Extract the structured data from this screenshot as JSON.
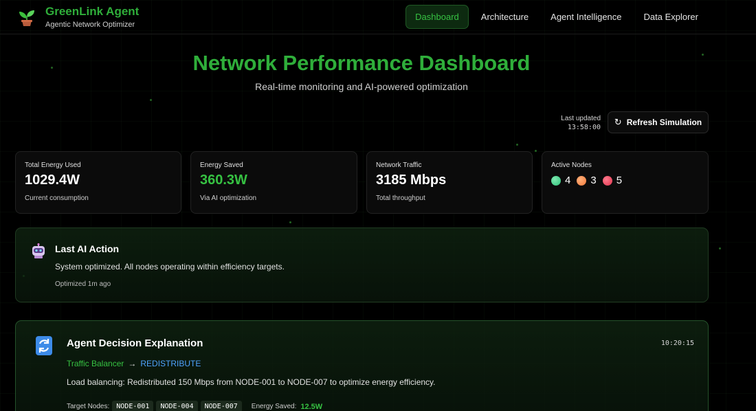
{
  "brand": {
    "title": "GreenLink Agent",
    "subtitle": "Agentic Network Optimizer"
  },
  "nav": [
    {
      "label": "Dashboard",
      "active": true
    },
    {
      "label": "Architecture",
      "active": false
    },
    {
      "label": "Agent Intelligence",
      "active": false
    },
    {
      "label": "Data Explorer",
      "active": false
    }
  ],
  "hero": {
    "title": "Network Performance Dashboard",
    "subtitle": "Real-time monitoring and AI-powered optimization"
  },
  "status": {
    "last_updated_label": "Last updated",
    "last_updated_time": "13:58:00",
    "refresh_label": "Refresh Simulation"
  },
  "metrics": {
    "energy_used": {
      "label": "Total Energy Used",
      "value": "1029.4W",
      "desc": "Current consumption"
    },
    "energy_saved": {
      "label": "Energy Saved",
      "value": "360.3W",
      "desc": "Via AI optimization"
    },
    "traffic": {
      "label": "Network Traffic",
      "value": "3185 Mbps",
      "desc": "Total throughput"
    },
    "active_nodes": {
      "label": "Active Nodes",
      "counts": [
        {
          "count": "4",
          "color": "#2fc27a"
        },
        {
          "count": "3",
          "color": "#f57a3c"
        },
        {
          "count": "5",
          "color": "#e0354f"
        }
      ]
    }
  },
  "last_action": {
    "title": "Last AI Action",
    "message": "System optimized. All nodes operating within efficiency targets.",
    "meta": "Optimized 1m ago"
  },
  "decision": {
    "title": "Agent Decision Explanation",
    "timestamp": "10:20:15",
    "agent": "Traffic Balancer",
    "arrow": "→",
    "action": "REDISTRIBUTE",
    "message": "Load balancing: Redistributed 150 Mbps from NODE-001 to NODE-007 to optimize energy efficiency.",
    "targets_label": "Target Nodes:",
    "targets": [
      "NODE-001",
      "NODE-004",
      "NODE-007"
    ],
    "saved_label": "Energy Saved:",
    "saved_value": "12.5W"
  },
  "colors": {
    "accent": "#2fae3a",
    "link": "#4ea3ff",
    "background": "#000000"
  }
}
